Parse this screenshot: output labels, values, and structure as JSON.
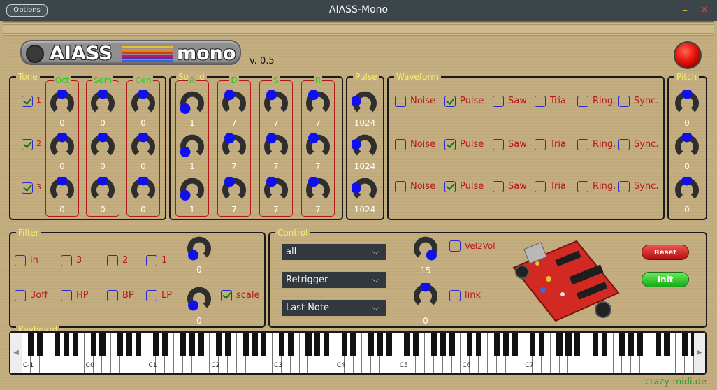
{
  "window": {
    "title": "AIASS-Mono",
    "options_label": "Options",
    "minimize": "–",
    "close": "✕"
  },
  "logo": {
    "text_left": "AIASS",
    "text_right": "mono",
    "stripe_colors": [
      "#e7c12a",
      "#e88a1c",
      "#d8381c",
      "#b41c6a",
      "#5a2ab4",
      "#2a6ad8"
    ]
  },
  "version": "v. 0.5",
  "tone": {
    "label": "Tone",
    "rows": [
      {
        "num": "1",
        "checked": true
      },
      {
        "num": "2",
        "checked": true
      },
      {
        "num": "3",
        "checked": true
      }
    ],
    "columns": [
      {
        "label": "Oct",
        "values": [
          "0",
          "0",
          "0"
        ]
      },
      {
        "label": "Sem",
        "values": [
          "0",
          "0",
          "0"
        ]
      },
      {
        "label": "Cen",
        "values": [
          "0",
          "0",
          "0"
        ]
      }
    ]
  },
  "sound": {
    "label": "Sound",
    "columns": [
      {
        "label": "A",
        "values": [
          "1",
          "1",
          "1"
        ]
      },
      {
        "label": "D",
        "values": [
          "7",
          "7",
          "7"
        ]
      },
      {
        "label": "S",
        "values": [
          "7",
          "7",
          "7"
        ]
      },
      {
        "label": "R",
        "values": [
          "7",
          "7",
          "7"
        ]
      }
    ]
  },
  "pulse": {
    "label": "Pulse",
    "values": [
      "1024",
      "1024",
      "1024"
    ]
  },
  "waveform": {
    "label": "Waveform",
    "options": [
      "Noise",
      "Pulse",
      "Saw",
      "Tria",
      "Ring.",
      "Sync."
    ],
    "rows": [
      [
        false,
        true,
        false,
        false,
        false,
        false
      ],
      [
        false,
        true,
        false,
        false,
        false,
        false
      ],
      [
        false,
        true,
        false,
        false,
        false,
        false
      ]
    ]
  },
  "pitch": {
    "label": "Pitch",
    "values": [
      "0",
      "0",
      "0"
    ]
  },
  "filter": {
    "label": "Filter",
    "row1": [
      {
        "label": "in",
        "checked": false
      },
      {
        "label": "3",
        "checked": false
      },
      {
        "label": "2",
        "checked": false
      },
      {
        "label": "1",
        "checked": false
      }
    ],
    "row2": [
      {
        "label": "3off",
        "checked": false
      },
      {
        "label": "HP",
        "checked": false
      },
      {
        "label": "BP",
        "checked": false
      },
      {
        "label": "LP",
        "checked": false
      }
    ],
    "knob1_value": "0",
    "knob2_value": "0",
    "scale": {
      "label": "scale",
      "checked": true
    }
  },
  "control": {
    "label": "Control",
    "dropdowns": [
      "all",
      "Retrigger",
      "Last Note"
    ],
    "knob1_value": "15",
    "knob2_value": "0",
    "vel2vol": {
      "label": "Vel2Vol",
      "checked": false
    },
    "link": {
      "label": "link",
      "checked": false
    },
    "reset_label": "Reset",
    "init_label": "Init"
  },
  "keyboard": {
    "label": "Keyboard",
    "octave_labels": [
      "C-1",
      "C0",
      "C1",
      "C2",
      "C3",
      "C4",
      "C5",
      "C6",
      "C7"
    ],
    "left_arrow": "◀",
    "right_arrow": "▶"
  },
  "credit": "crazy-midi.de",
  "colors": {
    "background": "#c4ae80",
    "panel_label": "#f4f06a",
    "knob_dot": "#1010ee",
    "knob_arc": "#2e2e2e",
    "led": "#ee1a10"
  }
}
